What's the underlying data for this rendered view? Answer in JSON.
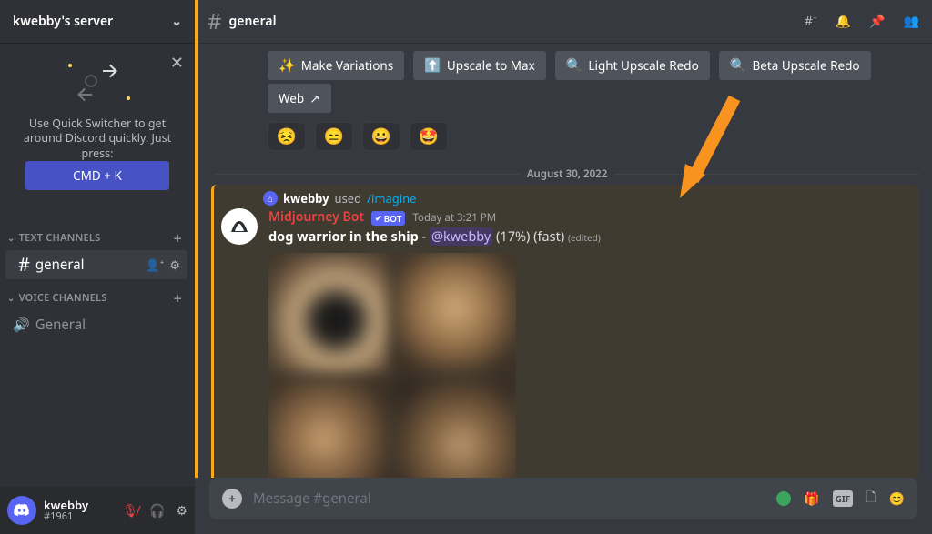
{
  "sidebar": {
    "server_name": "kwebby's server",
    "tip": {
      "text": "Use Quick Switcher to get around Discord quickly. Just press:",
      "button": "CMD + K"
    },
    "text_channels_label": "TEXT CHANNELS",
    "voice_channels_label": "VOICE CHANNELS",
    "text_channels": [
      {
        "name": "general"
      }
    ],
    "voice_channels": [
      {
        "name": "General"
      }
    ]
  },
  "header": {
    "channel": "general"
  },
  "buttons": {
    "variations": "Make Variations",
    "upscale_max": "Upscale to Max",
    "light_redo": "Light Upscale Redo",
    "beta_redo": "Beta Upscale Redo",
    "web": "Web"
  },
  "reactions": [
    "😣",
    "😑",
    "😀",
    "🤩"
  ],
  "divider_date": "August 30, 2022",
  "message": {
    "used_by": "kwebby",
    "used_word": "used",
    "command": "/imagine",
    "bot_name": "Midjourney Bot",
    "bot_tag": "BOT",
    "timestamp": "Today at 3:21 PM",
    "prompt": "dog warrior in the ship",
    "mention": "@kwebby",
    "progress": "(17%)",
    "mode": "(fast)",
    "edited": "(edited)"
  },
  "input": {
    "placeholder": "Message #general"
  },
  "user": {
    "name": "kwebby",
    "tag": "#1961"
  }
}
